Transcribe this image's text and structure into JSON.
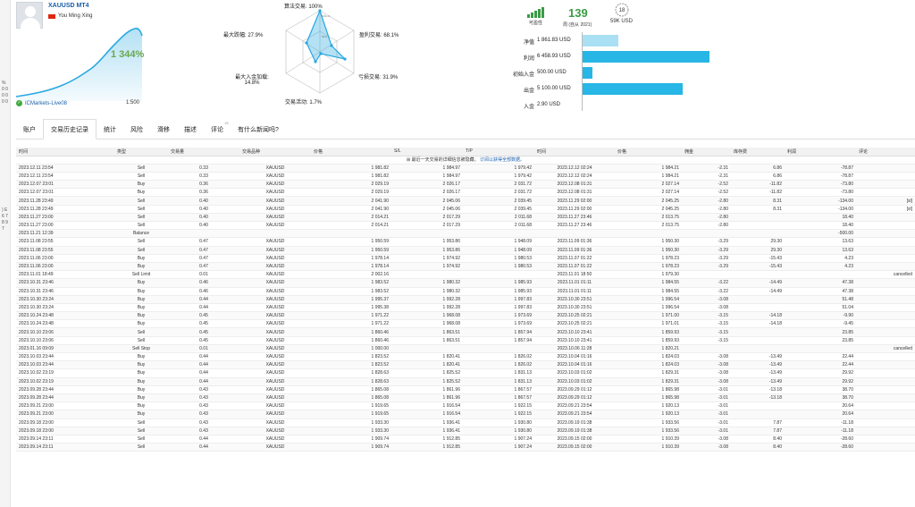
{
  "gutter": {
    "chars_top": "% 0 0 0 0 0 0",
    "chars_bottom": ") E 6 7 8 9 7"
  },
  "account": {
    "title": "XAUUSD MT4",
    "owner": "You Ming Xing",
    "growth": "1 344%",
    "broker": "ICMarkets-Live08",
    "leverage": "1:500"
  },
  "radar": {
    "top": "算法交易: 100%",
    "max_drawdown": "最大跌幅: 27.9%",
    "profit_trades": "盈利交易: 68.1%",
    "loss_trades": "亏损交易: 31.9%",
    "max_deposit_load": "最大入金加载: 14.8%",
    "activity": "交易活动: 1.7%",
    "inner_100": "100+%",
    "inner_50": "50%"
  },
  "stats": {
    "tradable_label": "可盈性",
    "weeks_value": "139",
    "weeks_label": "周 (自从 2021)",
    "badge_value": "18",
    "subscribers": "59K USD"
  },
  "kv": [
    {
      "label": "净值",
      "value": "1 861.83 USD",
      "fill": 0.28
    },
    {
      "label": "利润",
      "value": "6 458.93 USD",
      "fill": 1.0
    },
    {
      "label": "初始入金",
      "value": "500.00 USD",
      "fill": 0.08
    },
    {
      "label": "出金",
      "value": "5 100.00 USD",
      "fill": 0.79
    },
    {
      "label": "入金",
      "value": "2.90 USD",
      "fill": 0.0
    }
  ],
  "tabs": [
    {
      "label": "账户",
      "active": false
    },
    {
      "label": "交易历史记录",
      "active": true
    },
    {
      "label": "统计",
      "active": false
    },
    {
      "label": "风险",
      "active": false
    },
    {
      "label": "滑移",
      "active": false
    },
    {
      "label": "描述",
      "active": false
    },
    {
      "label": "评论",
      "active": false,
      "sup": "21"
    },
    {
      "label": "有什么新闻吗?",
      "active": false
    }
  ],
  "table": {
    "headers": [
      "时间",
      "类型",
      "交易量",
      "交易品种",
      "价格",
      "S/L",
      "T/P",
      "时间",
      "价格",
      "佣金",
      "库存费",
      "利润",
      "评论"
    ],
    "note": "最近一天交易的详细信息被隐藏。",
    "note_link": "订阅以获得全部数据。",
    "rows": [
      [
        "2023.12.11 23:54",
        "Sell",
        "0.33",
        "XAUUSD",
        "1 981.82",
        "1 984.97",
        "1 979.42",
        "2023.12.12 02:24",
        "1 984.21",
        "-2.31",
        "6.86",
        "-78.87",
        ""
      ],
      [
        "2023.12.11 23:54",
        "Sell",
        "0.33",
        "XAUUSD",
        "1 981.82",
        "1 984.97",
        "1 979.42",
        "2023.12.12 02:24",
        "1 984.21",
        "-2.31",
        "6.86",
        "-78.87",
        ""
      ],
      [
        "2023.12.07 23:01",
        "Buy",
        "0.36",
        "XAUUSD",
        "2 029.19",
        "2 026.17",
        "2 031.72",
        "2023.12.08 01:31",
        "2 027.14",
        "-2.52",
        "-11.82",
        "-73.80",
        ""
      ],
      [
        "2023.12.07 23:01",
        "Buy",
        "0.36",
        "XAUUSD",
        "2 029.19",
        "2 026.17",
        "2 031.72",
        "2023.12.08 01:31",
        "2 027.14",
        "-2.52",
        "-11.82",
        "-73.80",
        ""
      ],
      [
        "2023.11.28 23:49",
        "Sell",
        "0.40",
        "XAUUSD",
        "2 041.90",
        "2 045.06",
        "2 039.45",
        "2023.11.29 02:00",
        "2 045.25",
        "-2.80",
        "8.31",
        "-134.00",
        "[sl]"
      ],
      [
        "2023.11.28 23:49",
        "Sell",
        "0.40",
        "XAUUSD",
        "2 041.90",
        "2 045.06",
        "2 039.45",
        "2023.11.29 02:00",
        "2 045.25",
        "-2.80",
        "8.31",
        "-134.00",
        "[sl]"
      ],
      [
        "2023.11.27 23:00",
        "Sell",
        "0.40",
        "XAUUSD",
        "2 014.21",
        "2 017.29",
        "2 011.68",
        "2023.11.27 23:46",
        "2 013.75",
        "-2.80",
        "",
        "18.40",
        ""
      ],
      [
        "2023.11.27 23:00",
        "Sell",
        "0.40",
        "XAUUSD",
        "2 014.21",
        "2 017.29",
        "2 011.68",
        "2023.11.27 23:46",
        "2 013.75",
        "-2.80",
        "",
        "18.40",
        ""
      ],
      [
        "2023.11.21 12:39",
        "Balance",
        "",
        "",
        "",
        "",
        "",
        "",
        "",
        "",
        "",
        "-500.00",
        ""
      ],
      [
        "2023.11.08 23:55",
        "Sell",
        "0.47",
        "XAUUSD",
        "1 950.59",
        "1 953.86",
        "1 948.09",
        "2023.11.09 01:36",
        "1 950.30",
        "-3.29",
        "29.30",
        "13.63",
        ""
      ],
      [
        "2023.11.08 23:55",
        "Sell",
        "0.47",
        "XAUUSD",
        "1 950.59",
        "1 953.86",
        "1 948.09",
        "2023.11.09 01:36",
        "1 950.30",
        "-3.29",
        "29.30",
        "13.63",
        ""
      ],
      [
        "2023.11.06 23:00",
        "Buy",
        "0.47",
        "XAUUSD",
        "1 978.14",
        "1 974.92",
        "1 980.53",
        "2023.11.07 01:22",
        "1 978.23",
        "-3.29",
        "-15.43",
        "4.23",
        ""
      ],
      [
        "2023.11.06 23:00",
        "Buy",
        "0.47",
        "XAUUSD",
        "1 978.14",
        "1 974.92",
        "1 980.53",
        "2023.11.07 01:22",
        "1 978.23",
        "-3.29",
        "-15.43",
        "4.23",
        ""
      ],
      [
        "2023.11.01 18:49",
        "Sell Limit",
        "0.01",
        "XAUUSD",
        "2 002.16",
        "",
        "",
        "2023.11.01 18:50",
        "1 979.30",
        "",
        "",
        "",
        "cancelled"
      ],
      [
        "2023.10.31 23:46",
        "Buy",
        "0.46",
        "XAUUSD",
        "1 983.52",
        "1 980.32",
        "1 985.93",
        "2023.11.01 01:11",
        "1 984.55",
        "-3.22",
        "-14.49",
        "47.38",
        ""
      ],
      [
        "2023.10.31 23:46",
        "Buy",
        "0.46",
        "XAUUSD",
        "1 983.52",
        "1 980.32",
        "1 985.93",
        "2023.11.01 01:11",
        "1 984.55",
        "-3.22",
        "-14.49",
        "47.38",
        ""
      ],
      [
        "2023.10.30 23:24",
        "Buy",
        "0.44",
        "XAUUSD",
        "1 995.37",
        "1 992.28",
        "1 997.83",
        "2023.10.30 23:51",
        "1 996.54",
        "-3.08",
        "",
        "51.48",
        ""
      ],
      [
        "2023.10.30 23:24",
        "Buy",
        "0.44",
        "XAUUSD",
        "1 995.38",
        "1 992.28",
        "1 997.83",
        "2023.10.30 23:51",
        "1 996.54",
        "-3.08",
        "",
        "51.04",
        ""
      ],
      [
        "2023.10.24 23:48",
        "Buy",
        "0.45",
        "XAUUSD",
        "1 971.22",
        "1 968.08",
        "1 973.69",
        "2023.10.25 02:21",
        "1 971.00",
        "-3.15",
        "-14.18",
        "-9.90",
        ""
      ],
      [
        "2023.10.24 23:48",
        "Buy",
        "0.45",
        "XAUUSD",
        "1 971.22",
        "1 968.08",
        "1 973.69",
        "2023.10.25 02:21",
        "1 971.01",
        "-3.15",
        "-14.18",
        "-9.45",
        ""
      ],
      [
        "2023.10.10 23:06",
        "Sell",
        "0.45",
        "XAUUSD",
        "1 860.46",
        "1 863.51",
        "1 857.94",
        "2023.10.10 23:41",
        "1 859.93",
        "-3.15",
        "",
        "23.85",
        ""
      ],
      [
        "2023.10.10 23:06",
        "Sell",
        "0.45",
        "XAUUSD",
        "1 860.46",
        "1 863.51",
        "1 857.94",
        "2023.10.10 23:41",
        "1 859.93",
        "-3.15",
        "",
        "23.85",
        ""
      ],
      [
        "2023.01.16 09:09",
        "Sell Stop",
        "0.01",
        "XAUUSD",
        "1 000.00",
        "",
        "",
        "2023.10.06 11:28",
        "1 820.21",
        "",
        "",
        "",
        "cancelled"
      ],
      [
        "2023.10.03 23:44",
        "Buy",
        "0.44",
        "XAUUSD",
        "1 823.52",
        "1 820.41",
        "1 826.02",
        "2023.10.04 01:16",
        "1 824.03",
        "-3.08",
        "-13.49",
        "22.44",
        ""
      ],
      [
        "2023.10.03 23:44",
        "Buy",
        "0.44",
        "XAUUSD",
        "1 823.52",
        "1 820.41",
        "1 826.02",
        "2023.10.04 01:16",
        "1 824.03",
        "-3.08",
        "-13.49",
        "22.44",
        ""
      ],
      [
        "2023.10.02 23:19",
        "Buy",
        "0.44",
        "XAUUSD",
        "1 828.63",
        "1 825.52",
        "1 831.13",
        "2023.10.03 01:02",
        "1 829.31",
        "-3.08",
        "-13.49",
        "29.92",
        ""
      ],
      [
        "2023.10.02 23:19",
        "Buy",
        "0.44",
        "XAUUSD",
        "1 828.63",
        "1 825.52",
        "1 831.13",
        "2023.10.03 01:02",
        "1 829.31",
        "-3.08",
        "-13.49",
        "29.92",
        ""
      ],
      [
        "2023.09.28 23:44",
        "Buy",
        "0.43",
        "XAUUSD",
        "1 865.08",
        "1 861.96",
        "1 867.57",
        "2023.09.29 01:12",
        "1 865.98",
        "-3.01",
        "-13.18",
        "38.70",
        ""
      ],
      [
        "2023.09.28 23:44",
        "Buy",
        "0.43",
        "XAUUSD",
        "1 865.08",
        "1 861.96",
        "1 867.57",
        "2023.09.29 01:12",
        "1 865.98",
        "-3.01",
        "-13.18",
        "38.70",
        ""
      ],
      [
        "2023.09.21 23:00",
        "Buy",
        "0.43",
        "XAUUSD",
        "1 919.65",
        "1 916.54",
        "1 922.15",
        "2023.09.21 23:54",
        "1 920.13",
        "-3.01",
        "",
        "20.64",
        ""
      ],
      [
        "2023.09.21 23:00",
        "Buy",
        "0.43",
        "XAUUSD",
        "1 919.65",
        "1 916.54",
        "1 922.15",
        "2023.09.21 23:54",
        "1 920.13",
        "-3.01",
        "",
        "20.64",
        ""
      ],
      [
        "2023.09.18 23:00",
        "Sell",
        "0.43",
        "XAUUSD",
        "1 933.30",
        "1 936.41",
        "1 930.80",
        "2023.09.19 01:38",
        "1 933.56",
        "-3.01",
        "7.87",
        "-11.18",
        ""
      ],
      [
        "2023.09.18 23:00",
        "Sell",
        "0.43",
        "XAUUSD",
        "1 933.30",
        "1 936.41",
        "1 930.80",
        "2023.09.19 01:38",
        "1 933.56",
        "-3.01",
        "7.87",
        "-11.18",
        ""
      ],
      [
        "2023.09.14 23:11",
        "Sell",
        "0.44",
        "XAUUSD",
        "1 909.74",
        "1 912.85",
        "1 907.24",
        "2023.09.15 02:00",
        "1 910.39",
        "-3.08",
        "8.40",
        "-28.60",
        ""
      ],
      [
        "2023.09.14 23:11",
        "Sell",
        "0.44",
        "XAUUSD",
        "1 909.74",
        "1 912.85",
        "1 907.24",
        "2023.09.15 02:00",
        "1 910.39",
        "-3.08",
        "8.40",
        "-28.60",
        ""
      ]
    ]
  },
  "colors": {
    "accent": "#27b6e6",
    "growth": "#6aa84f",
    "loss": "#e03b3b",
    "swap_pos": "#2f7fd0",
    "radar_fill": "#29a8e0"
  }
}
